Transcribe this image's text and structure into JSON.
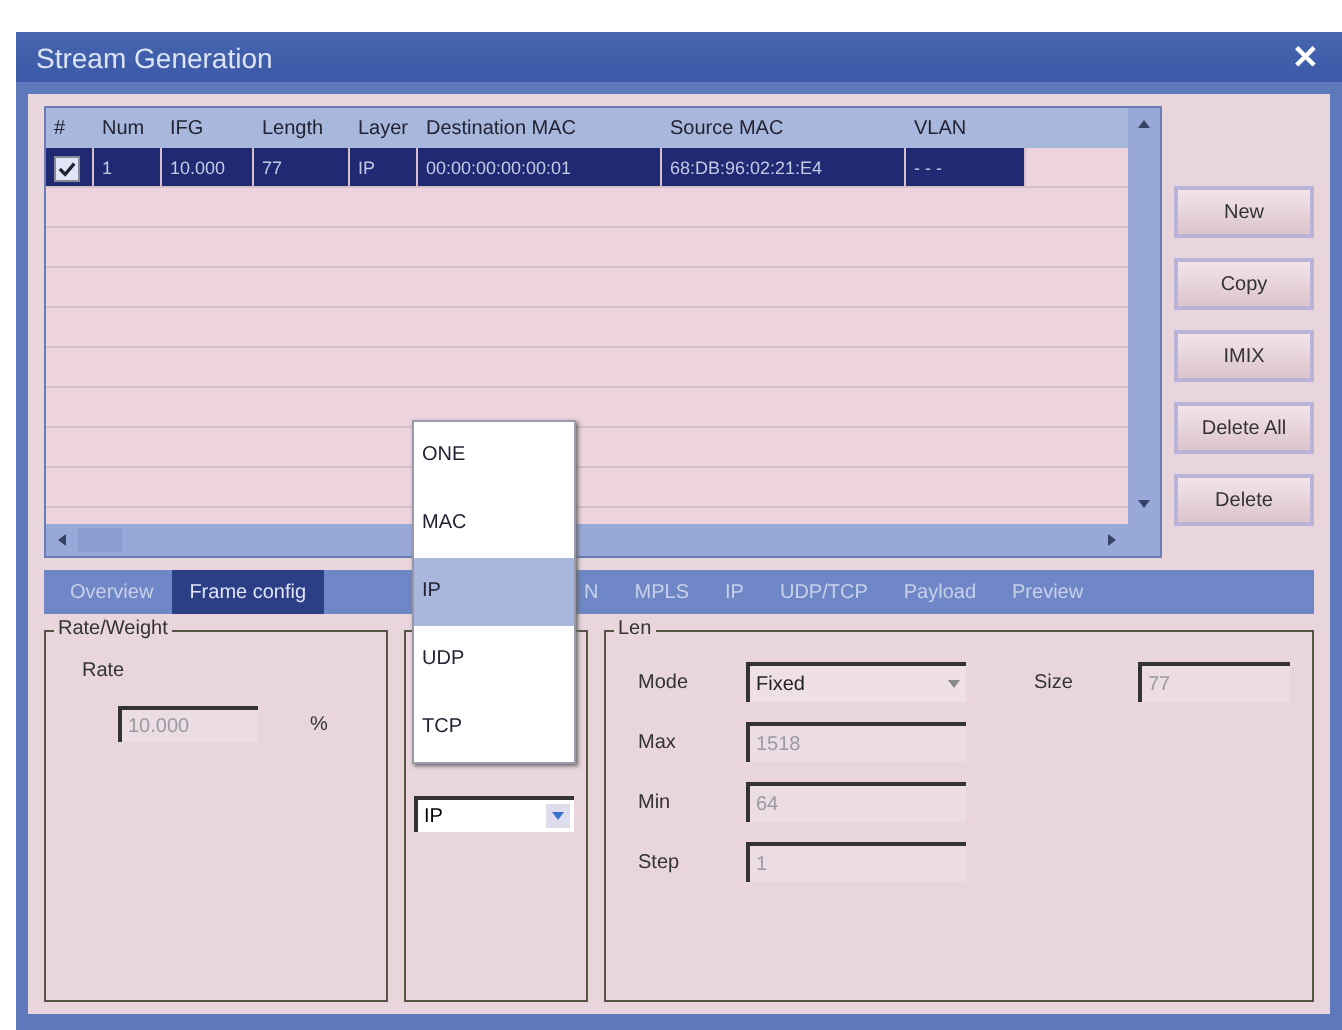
{
  "window": {
    "title": "Stream Generation",
    "close": "✕"
  },
  "table": {
    "columns": [
      "#",
      "Num",
      "IFG",
      "Length",
      "Layer",
      "Destination MAC",
      "Source MAC",
      "VLAN"
    ],
    "rows": [
      {
        "checked": true,
        "selected": true,
        "cells": [
          "",
          "1",
          "10.000",
          "77",
          "IP",
          "00:00:00:00:00:01",
          "68:DB:96:02:21:E4",
          "- - -"
        ]
      }
    ]
  },
  "buttons": [
    "New",
    "Copy",
    "IMIX",
    "Delete All",
    "Delete"
  ],
  "tabs": [
    {
      "label": "Overview",
      "selected": false
    },
    {
      "label": "Frame config",
      "selected": true
    },
    {
      "label": "N",
      "selected": false
    },
    {
      "label": "MPLS",
      "selected": false
    },
    {
      "label": "IP",
      "selected": false
    },
    {
      "label": "UDP/TCP",
      "selected": false
    },
    {
      "label": "Payload",
      "selected": false
    },
    {
      "label": "Preview",
      "selected": false
    }
  ],
  "rate_weight": {
    "title": "Rate/Weight",
    "label": "Rate",
    "value": "10.000",
    "unit": "%",
    "disabled": true
  },
  "layer_select": {
    "value": "IP",
    "options": [
      {
        "label": "ONE",
        "selected": false
      },
      {
        "label": "MAC",
        "selected": false
      },
      {
        "label": "IP",
        "selected": true
      },
      {
        "label": "UDP",
        "selected": false
      },
      {
        "label": "TCP",
        "selected": false
      }
    ]
  },
  "len": {
    "title": "Len",
    "rows": [
      {
        "fields": [
          {
            "label": "Mode",
            "value": "Fixed",
            "kind": "select",
            "disabled": false
          },
          {
            "label": "Size",
            "value": "77",
            "kind": "input",
            "disabled": true
          }
        ]
      },
      {
        "fields": [
          {
            "label": "Max",
            "value": "1518",
            "kind": "input",
            "disabled": true
          }
        ]
      },
      {
        "fields": [
          {
            "label": "Min",
            "value": "64",
            "kind": "input",
            "disabled": true
          }
        ]
      },
      {
        "fields": [
          {
            "label": "Step",
            "value": "1",
            "kind": "input",
            "disabled": true
          }
        ]
      }
    ]
  }
}
